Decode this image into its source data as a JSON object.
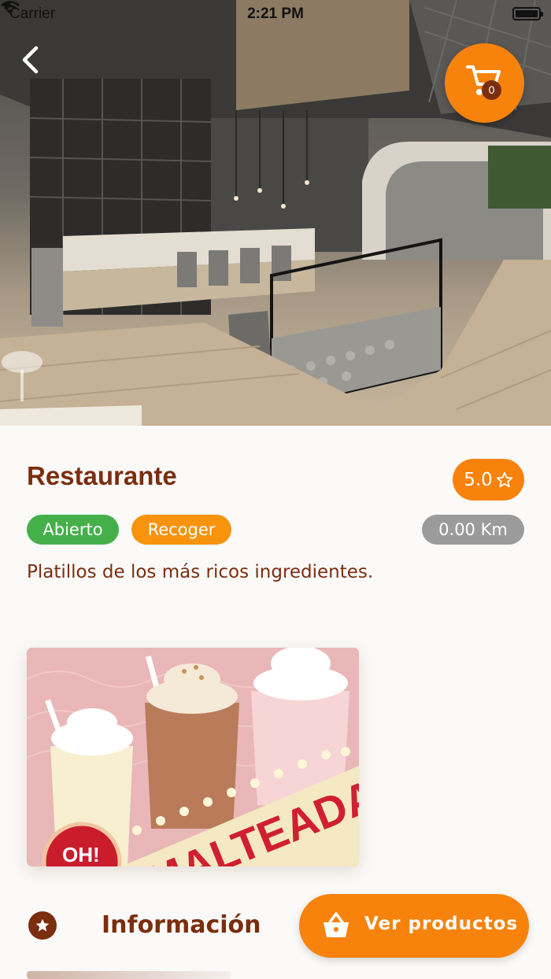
{
  "status_bar": {
    "carrier": "Carrier",
    "time": "2:21 PM"
  },
  "header": {
    "back_icon": "chevron-left-icon",
    "cart_icon": "cart-icon",
    "cart_count": "0"
  },
  "restaurant": {
    "name": "Restaurante",
    "rating": "5.0",
    "rating_icon": "star-outline-icon",
    "status": "Abierto",
    "mode": "Recoger",
    "distance": "0.00 Km",
    "description": "Platillos de los más ricos ingredientes."
  },
  "promo": {
    "banner_text": "MALTEADAS",
    "badge_text": "OH!"
  },
  "footer": {
    "info_label": "Información",
    "info_icon": "star-circle-icon",
    "cta_label": "Ver productos",
    "cta_icon": "basket-icon"
  },
  "colors": {
    "brand_orange": "#f7830c",
    "brand_brown": "#7b2e0e",
    "open_green": "#45b04a",
    "pickup_orange": "#f8930d",
    "distance_gray": "#9b9b9b"
  }
}
